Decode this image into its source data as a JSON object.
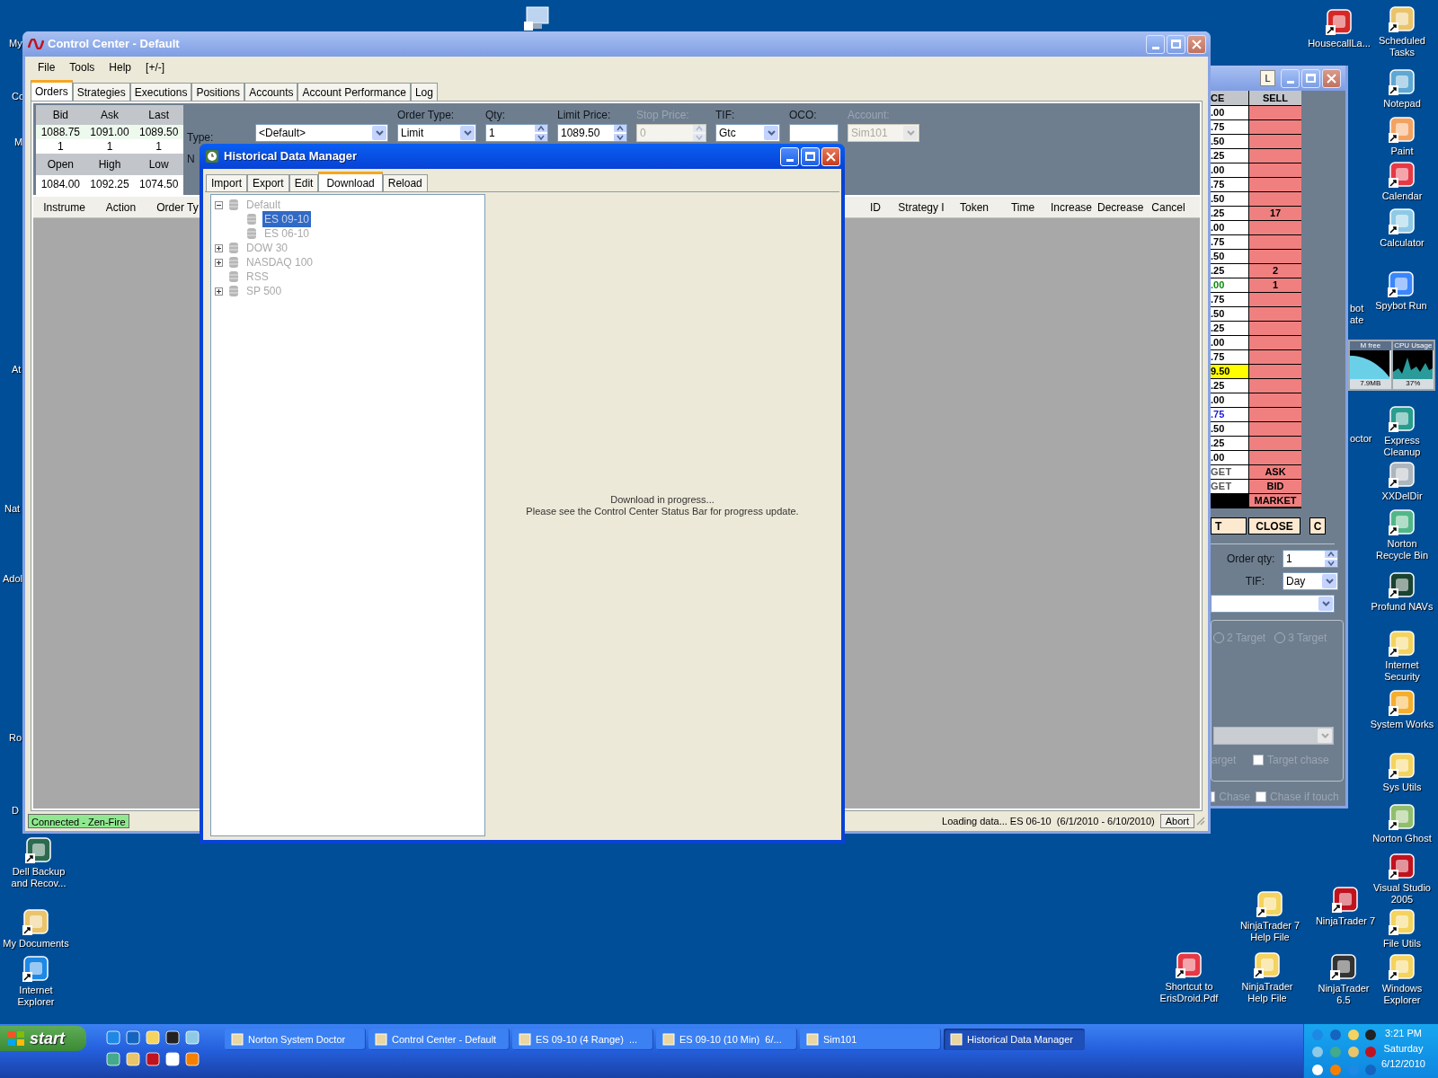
{
  "desktop": {
    "icons": [
      {
        "label": "HousecallLa..."
      },
      {
        "label": "Scheduled Tasks"
      },
      {
        "label": "Notepad"
      },
      {
        "label": "Paint"
      },
      {
        "label": "Calendar"
      },
      {
        "label": "Calculator"
      },
      {
        "label": "Spybot Run"
      },
      {
        "label": "Express Cleanup"
      },
      {
        "label": "XXDelDir"
      },
      {
        "label": "Norton Recycle Bin"
      },
      {
        "label": "Profund NAVs"
      },
      {
        "label": "Internet Security"
      },
      {
        "label": "System Works"
      },
      {
        "label": "Sys Utils"
      },
      {
        "label": "Norton Ghost"
      },
      {
        "label": "Visual Studio 2005"
      },
      {
        "label": "File Utils"
      },
      {
        "label": "Windows Explorer"
      },
      {
        "label": "NinjaTrader 7 Help File"
      },
      {
        "label": "NinjaTrader 7"
      },
      {
        "label": "Shortcut to ErisDroid.Pdf"
      },
      {
        "label": "NinjaTrader Help File"
      },
      {
        "label": "NinjaTrader 6.5"
      },
      {
        "label": "Dell Backup and Recov..."
      },
      {
        "label": "My Documents"
      },
      {
        "label": "Internet Explorer"
      }
    ],
    "fragments": [
      "My",
      "Co",
      "M",
      "At",
      "Nat",
      "Adol",
      "Ro",
      "D",
      "bot ate",
      "octor"
    ],
    "gadget": [
      {
        "title": "M free",
        "value": "7.9MB"
      },
      {
        "title": "CPU Usage",
        "value": "37%"
      }
    ]
  },
  "control_center": {
    "title": "Control Center - Default",
    "menu": [
      "File",
      "Tools",
      "Help",
      "[+/-]"
    ],
    "tabs": [
      {
        "label": "Orders",
        "selected": true
      },
      {
        "label": "Strategies",
        "selected": false
      },
      {
        "label": "Executions",
        "selected": false
      },
      {
        "label": "Positions",
        "selected": false
      },
      {
        "label": "Accounts",
        "selected": false
      },
      {
        "label": "Account Performance",
        "selected": false
      },
      {
        "label": "Log",
        "selected": false
      }
    ],
    "quote": {
      "headers": [
        "Bid",
        "Ask",
        "Last"
      ],
      "prices": [
        "1088.75",
        "1091.00",
        "1089.50"
      ],
      "sizes": [
        "1",
        "1",
        "1"
      ],
      "headers2": [
        "Open",
        "High",
        "Low"
      ],
      "prices2": [
        "1084.00",
        "1092.25",
        "1074.50"
      ]
    },
    "order_entry": {
      "type_label": "Type:",
      "type_value": "<Default>",
      "cut_label": "N",
      "fields": [
        {
          "label": "Order Type:",
          "kind": "dropdown",
          "value": "Limit",
          "disabled": false
        },
        {
          "label": "Qty:",
          "kind": "spinner",
          "value": "1",
          "disabled": false
        },
        {
          "label": "Limit Price:",
          "kind": "spinner",
          "value": "1089.50",
          "disabled": false
        },
        {
          "label": "Stop Price:",
          "kind": "spinner",
          "value": "0",
          "disabled": true
        },
        {
          "label": "TIF:",
          "kind": "dropdown",
          "value": "Gtc",
          "disabled": false
        },
        {
          "label": "OCO:",
          "kind": "text",
          "disabled": false
        },
        {
          "label": "Account:",
          "kind": "dropdown",
          "value": "Sim101",
          "disabled": true
        }
      ]
    },
    "orders_grid": {
      "columns_left": [
        "Instrume",
        "Action",
        "Order Ty"
      ],
      "columns_right": [
        "ID",
        "Strategy I",
        "Token",
        "Time",
        "Increase",
        "Decrease",
        "Cancel"
      ]
    },
    "status_bar": {
      "connection": "Connected - Zen-Fire",
      "message": "Loading data... ES 06-10  (6/1/2010 - 6/10/2010)",
      "abort": "Abort"
    }
  },
  "dom_window": {
    "title_button": "L",
    "columns": [
      "CE",
      "SELL"
    ],
    "rows": [
      {
        "price": ".00",
        "kind": "normal"
      },
      {
        "price": ".75",
        "kind": "normal"
      },
      {
        "price": ".50",
        "kind": "normal"
      },
      {
        "price": ".25",
        "kind": "normal"
      },
      {
        "price": ".00",
        "kind": "normal"
      },
      {
        "price": ".75",
        "kind": "normal"
      },
      {
        "price": ".50",
        "kind": "normal"
      },
      {
        "price": ".25",
        "sell": "17",
        "kind": "normal"
      },
      {
        "price": ".00",
        "kind": "normal"
      },
      {
        "price": ".75",
        "kind": "normal"
      },
      {
        "price": ".50",
        "kind": "normal"
      },
      {
        "price": ".25",
        "sell": "2",
        "kind": "normal"
      },
      {
        "price": ".00",
        "sell": "1",
        "kind": "ask"
      },
      {
        "price": ".75",
        "kind": "normal"
      },
      {
        "price": ".50",
        "kind": "normal"
      },
      {
        "price": ".25",
        "kind": "normal"
      },
      {
        "price": ".00",
        "kind": "normal"
      },
      {
        "price": ".75",
        "kind": "normal"
      },
      {
        "price": "9.50",
        "kind": "last"
      },
      {
        "price": ".25",
        "kind": "normal"
      },
      {
        "price": ".00",
        "kind": "normal"
      },
      {
        "price": ".75",
        "kind": "bid"
      },
      {
        "price": ".50",
        "kind": "normal"
      },
      {
        "price": ".25",
        "kind": "normal"
      },
      {
        "price": ".00",
        "kind": "normal"
      }
    ],
    "action_rows": [
      {
        "left": "GET",
        "right": "ASK",
        "kind": "target"
      },
      {
        "left": "GET",
        "right": "BID",
        "kind": "target"
      },
      {
        "right": "MARKET",
        "kind": "market"
      }
    ],
    "buttons": [
      "T",
      "CLOSE",
      "C"
    ],
    "order_qty": {
      "label": "Order qty:",
      "value": "1"
    },
    "tif": {
      "label": "TIF:",
      "value": "Day"
    },
    "targets": [
      {
        "label": "2 Target",
        "selected": false
      },
      {
        "label": "3 Target",
        "selected": false
      }
    ],
    "cut_label": "arget",
    "checkboxes": [
      {
        "label": "Target chase",
        "checked": false
      },
      {
        "label": "Chase",
        "checked": false
      },
      {
        "label": "Chase if touch",
        "checked": false
      }
    ]
  },
  "hdm": {
    "title": "Historical Data Manager",
    "tabs": [
      {
        "label": "Import",
        "selected": false
      },
      {
        "label": "Export",
        "selected": false
      },
      {
        "label": "Edit",
        "selected": false
      },
      {
        "label": "Download",
        "selected": true
      },
      {
        "label": "Reload",
        "selected": false
      }
    ],
    "tree": [
      {
        "label": "Default",
        "expandable": true,
        "expanded": true,
        "selected": false,
        "children": [
          {
            "label": "ES 09-10",
            "selected": true
          },
          {
            "label": "ES 06-10",
            "selected": false
          }
        ]
      },
      {
        "label": "DOW 30",
        "expandable": true,
        "expanded": false,
        "selected": false
      },
      {
        "label": "NASDAQ 100",
        "expandable": true,
        "expanded": false,
        "selected": false
      },
      {
        "label": "RSS",
        "expandable": false,
        "selected": false
      },
      {
        "label": "SP 500",
        "expandable": true,
        "expanded": false,
        "selected": false
      }
    ],
    "message": [
      "Download in progress...",
      "Please see the Control Center Status Bar for progress update."
    ]
  },
  "taskbar": {
    "start": "start",
    "tasks": [
      {
        "label": "Norton System Doctor",
        "selected": false
      },
      {
        "label": "Control Center - Default",
        "selected": false
      },
      {
        "label": "ES 09-10 (4 Range)  ...",
        "selected": false
      },
      {
        "label": "ES 09-10 (10 Min)  6/...",
        "selected": false
      },
      {
        "label": "Sim101",
        "selected": false
      },
      {
        "label": "Historical Data Manager",
        "selected": true
      }
    ],
    "clock": {
      "time": "3:21 PM",
      "day": "Saturday",
      "date": "6/12/2010"
    }
  }
}
